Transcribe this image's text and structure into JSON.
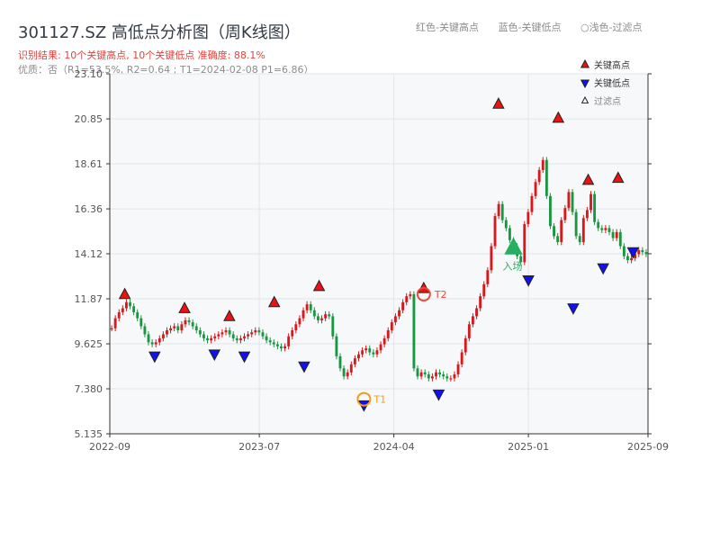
{
  "header": {
    "title": "301127.SZ 高低点分析图（周K线图）",
    "result_line": "识别结果: 10个关键高点, 10个关键低点  准确度: 88.1%",
    "quality_line": "优质：否（R1=53.5%, R2=0.64 ; T1=2024-02-08 P1=6.86）",
    "legend_red": "红色-关键高点",
    "legend_blue": "蓝色-关键低点",
    "legend_light": "○浅色-过滤点"
  },
  "legend": {
    "high": "关键高点",
    "low": "关键低点",
    "filtered": "过滤点"
  },
  "colors": {
    "up": "#d7191c",
    "down": "#1a9641",
    "high_marker": "#ee1111",
    "low_marker": "#1111ee",
    "t_marker": "#f39c12",
    "t2_marker": "#e74c3c",
    "entry": "#27ae60",
    "plot_bg": "#f6f8fa"
  },
  "chart_data": {
    "type": "candlestick",
    "ylim": [
      5.135,
      23.1
    ],
    "yticks": [
      "5.135",
      "7.380",
      "9.625",
      "11.87",
      "14.12",
      "16.36",
      "18.61",
      "20.85",
      "23.10"
    ],
    "xticks": [
      "2022-09",
      "2023-07",
      "2024-04",
      "2025-01",
      "2025-09"
    ],
    "x_start": "2022-09",
    "x_end": "2025-09",
    "weekly_closes": [
      10.4,
      10.9,
      11.2,
      11.4,
      11.7,
      11.5,
      11.2,
      10.9,
      10.5,
      10.1,
      9.7,
      9.6,
      9.7,
      9.9,
      10.1,
      10.3,
      10.4,
      10.5,
      10.3,
      10.6,
      10.8,
      10.7,
      10.5,
      10.3,
      10.1,
      9.9,
      9.8,
      9.9,
      10.0,
      10.1,
      10.2,
      10.3,
      10.1,
      9.9,
      9.8,
      9.9,
      10.0,
      10.1,
      10.2,
      10.3,
      10.2,
      10.0,
      9.8,
      9.7,
      9.6,
      9.5,
      9.4,
      9.5,
      10.0,
      10.3,
      10.6,
      10.9,
      11.3,
      11.6,
      11.3,
      11.0,
      10.8,
      10.9,
      11.1,
      11.0,
      10.0,
      9.0,
      8.4,
      8.0,
      8.2,
      8.6,
      8.9,
      9.1,
      9.3,
      9.4,
      9.2,
      9.1,
      9.3,
      9.6,
      9.9,
      10.3,
      10.7,
      11.0,
      11.3,
      11.7,
      12.0,
      12.1,
      8.4,
      8.0,
      8.2,
      8.1,
      7.9,
      8.0,
      8.2,
      8.1,
      8.0,
      7.9,
      7.9,
      8.1,
      8.6,
      9.2,
      9.9,
      10.6,
      11.0,
      11.4,
      12.0,
      12.6,
      13.3,
      14.5,
      16.0,
      16.6,
      15.8,
      15.4,
      14.8,
      14.5,
      14.0,
      13.7,
      15.6,
      16.2,
      17.0,
      17.7,
      18.3,
      18.8,
      17.0,
      15.5,
      15.0,
      14.7,
      15.8,
      16.4,
      17.2,
      16.2,
      15.0,
      14.7,
      15.9,
      16.3,
      17.1,
      15.7,
      15.4,
      15.3,
      15.4,
      15.2,
      14.9,
      15.2,
      14.5,
      14.0,
      13.8,
      13.9,
      14.1,
      14.3,
      14.2,
      14.1
    ],
    "key_highs": [
      {
        "date": "2022-10",
        "price": 11.8
      },
      {
        "date": "2023-02",
        "price": 11.1
      },
      {
        "date": "2023-05",
        "price": 10.7
      },
      {
        "date": "2023-08",
        "price": 11.4
      },
      {
        "date": "2023-11",
        "price": 12.2
      },
      {
        "date": "2024-06",
        "price": 12.1
      },
      {
        "date": "2024-11",
        "price": 21.3
      },
      {
        "date": "2025-03",
        "price": 20.6
      },
      {
        "date": "2025-05",
        "price": 17.5
      },
      {
        "date": "2025-07",
        "price": 17.6
      }
    ],
    "key_lows": [
      {
        "date": "2022-12",
        "price": 9.3
      },
      {
        "date": "2023-04",
        "price": 9.4
      },
      {
        "date": "2023-06",
        "price": 9.3
      },
      {
        "date": "2023-10",
        "price": 8.8
      },
      {
        "date": "2024-02",
        "price": 6.86
      },
      {
        "date": "2024-07",
        "price": 7.4
      },
      {
        "date": "2025-01",
        "price": 13.1
      },
      {
        "date": "2025-04",
        "price": 11.7
      },
      {
        "date": "2025-06",
        "price": 13.7
      },
      {
        "date": "2025-08",
        "price": 14.5
      }
    ],
    "annotations": [
      {
        "label": "T1",
        "date": "2024-02",
        "price": 6.86
      },
      {
        "label": "T2",
        "date": "2024-06",
        "price": 12.1
      },
      {
        "label": "入场",
        "date": "2024-12",
        "price": 14.4
      }
    ]
  }
}
